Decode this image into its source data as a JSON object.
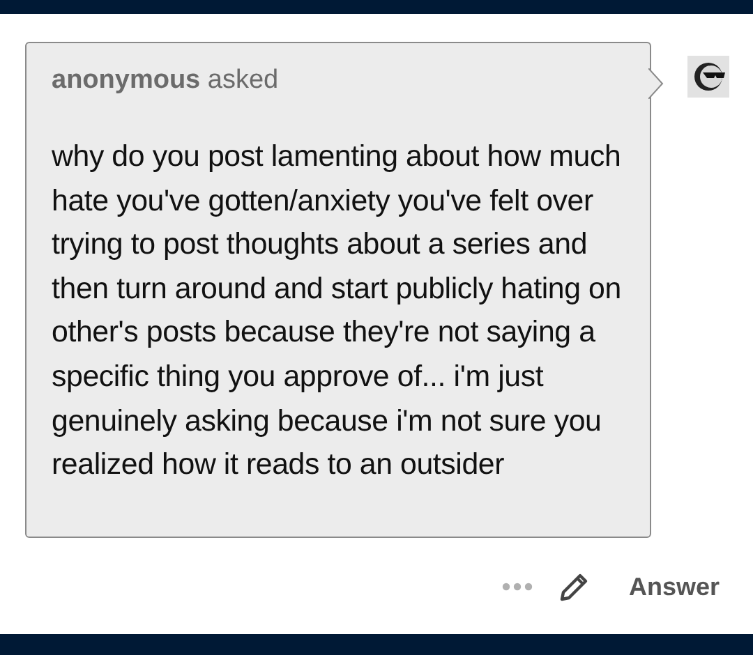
{
  "ask": {
    "asker": "anonymous",
    "verb": "asked",
    "question": "why do you post lamenting about how much hate you've gotten/anxiety you've felt over trying to post thoughts about a series and then turn around and start publicly hating on other's posts because they're not saying a specific thing you approve of... i'm just genuinely asking because i'm not sure you realized how it reads to an outsider"
  },
  "actions": [
    {
      "kind": "more"
    },
    {
      "kind": "edit"
    },
    {
      "kind": "text",
      "label": "Answer"
    }
  ]
}
